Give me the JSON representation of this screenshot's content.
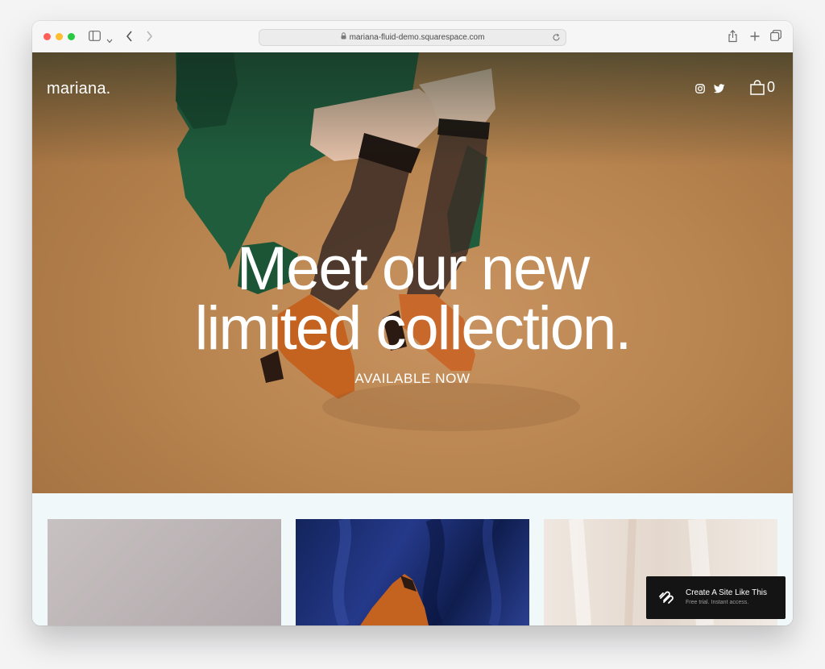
{
  "browser": {
    "url": "mariana-fluid-demo.squarespace.com"
  },
  "site": {
    "logo": "mariana.",
    "cart_count": "0"
  },
  "hero": {
    "headline_line1": "Meet our new",
    "headline_line2": "limited collection.",
    "subheadline": "AVAILABLE NOW"
  },
  "promo": {
    "title": "Create A Site Like This",
    "subtitle": "Free trial. Instant access."
  },
  "colors": {
    "hero_background": "#b8844f",
    "dress_green": "#1f5d3d",
    "shoe_orange": "#c4621f",
    "page_background": "#f1f8fa",
    "promo_background": "#141414"
  },
  "icons": [
    "sidebar-icon",
    "chevron-down-icon",
    "back-icon",
    "forward-icon",
    "lock-icon",
    "reload-icon",
    "share-icon",
    "new-tab-icon",
    "tabs-overview-icon",
    "instagram-icon",
    "twitter-icon",
    "shopping-bag-icon",
    "squarespace-logo-icon"
  ]
}
